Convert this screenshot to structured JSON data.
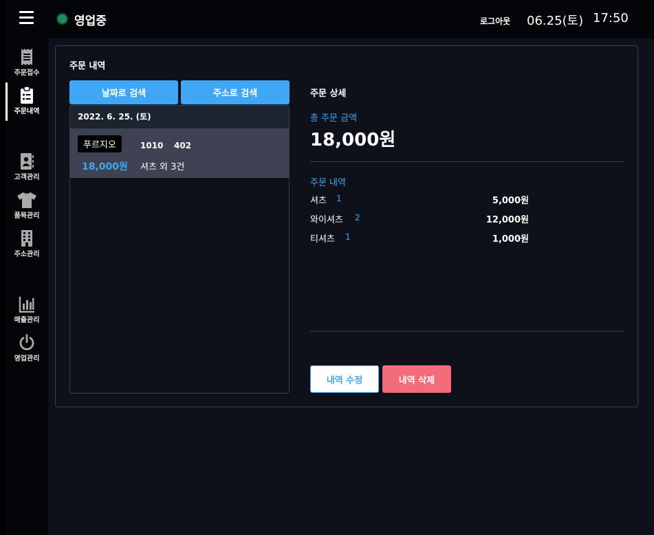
{
  "header": {
    "status_text": "영업중",
    "status_color": "#1c8f5c",
    "logout_label": "로그아웃",
    "date": "06.25(토)",
    "time": "17:50"
  },
  "sidebar": {
    "items": [
      {
        "label": "주문접수",
        "icon": "receipt-icon"
      },
      {
        "label": "주문내역",
        "icon": "clipboard-list-icon",
        "active": true
      },
      {
        "label": "고객관리",
        "icon": "address-book-icon"
      },
      {
        "label": "품목관리",
        "icon": "shirt-icon"
      },
      {
        "label": "주소관리",
        "icon": "building-icon"
      },
      {
        "label": "매출관리",
        "icon": "bar-chart-icon"
      },
      {
        "label": "영업관리",
        "icon": "power-icon"
      }
    ]
  },
  "main": {
    "title": "주문 내역",
    "search_by_date_label": "날짜로 검색",
    "search_by_address_label": "주소로 검색",
    "list": {
      "date_header": "2022. 6. 25. (토)",
      "orders": [
        {
          "customer": "푸르지오",
          "building": "1010",
          "unit": "402",
          "amount": "18,000원",
          "summary": "셔츠 외 3건"
        }
      ]
    },
    "detail": {
      "title": "주문 상세",
      "total_label": "총 주문 금액",
      "total_amount": "18,000원",
      "items_label": "주문 내역",
      "items": [
        {
          "name": "셔츠",
          "qty": "1",
          "price": "5,000원"
        },
        {
          "name": "와이셔츠",
          "qty": "2",
          "price": "12,000원"
        },
        {
          "name": "티셔츠",
          "qty": "1",
          "price": "1,000원"
        }
      ],
      "edit_label": "내역 수정",
      "delete_label": "내역 삭제"
    }
  },
  "colors": {
    "accent": "#3fa7f5",
    "danger": "#f26c7c",
    "background": "#0e1119",
    "row_selected": "#3e4252"
  }
}
